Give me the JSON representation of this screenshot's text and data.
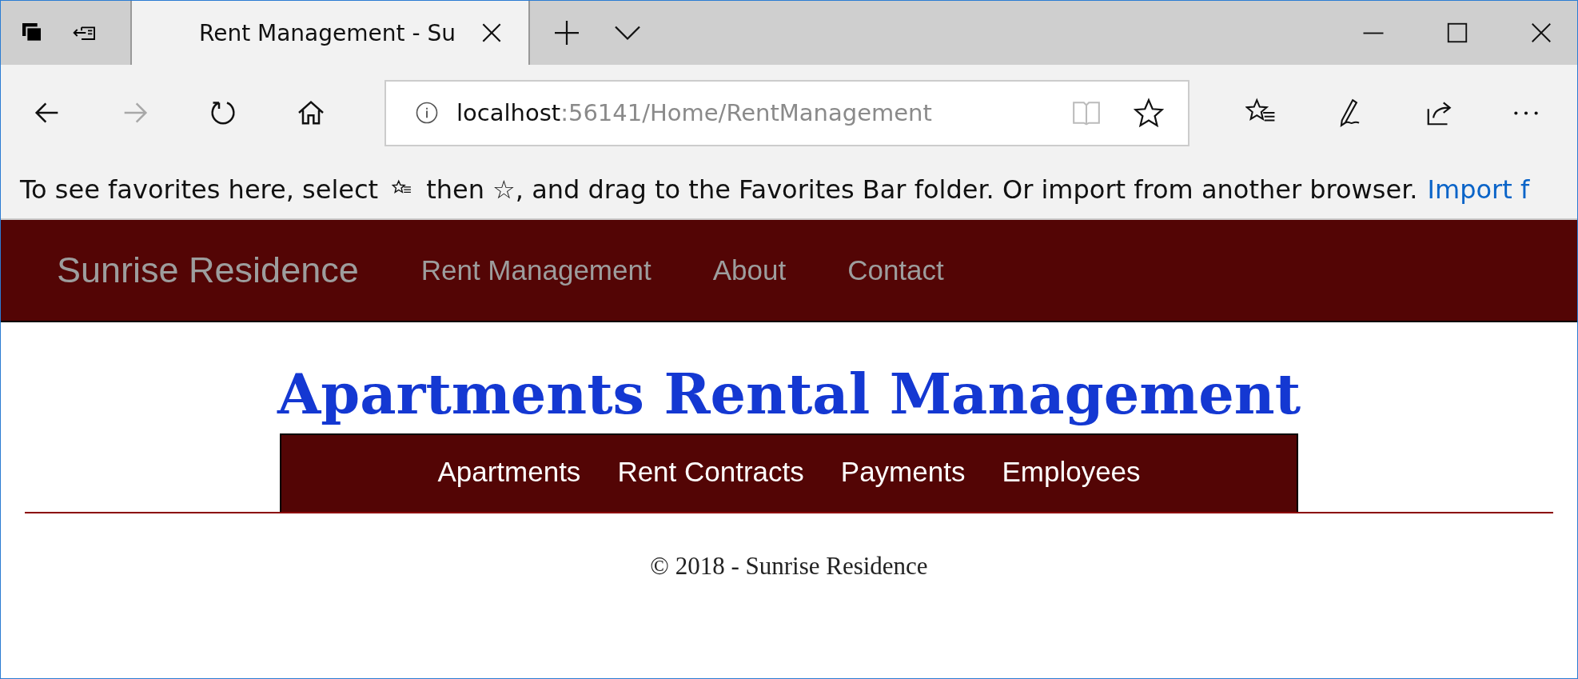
{
  "browser": {
    "tabs": [
      {
        "title": "Rent Management - Su",
        "selected": true
      }
    ],
    "toolbar": [
      {
        "kind": "back",
        "disabled": false
      },
      {
        "kind": "forward",
        "disabled": true
      },
      {
        "kind": "refresh",
        "disabled": false
      },
      {
        "kind": "home",
        "disabled": false
      }
    ],
    "address": {
      "host": "localhost",
      "path": ":56141/Home/RentManagement"
    },
    "favorites_bar": {
      "message_start": "To see favorites here, select",
      "message_mid": "then ☆, and drag to the Favorites Bar folder. Or import from another browser.",
      "link": "Import f"
    }
  },
  "navbar": {
    "brand": "Sunrise Residence",
    "links": [
      "Rent Management",
      "About",
      "Contact"
    ]
  },
  "page": {
    "title": "Apartments Rental Management",
    "menu": [
      "Apartments",
      "Rent Contracts",
      "Payments",
      "Employees"
    ],
    "footer": "© 2018 - Sunrise Residence"
  }
}
